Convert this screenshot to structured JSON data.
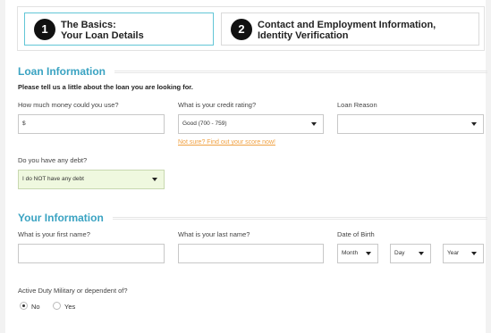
{
  "steps": [
    {
      "number": "1",
      "line1": "The Basics:",
      "line2": "Your Loan Details",
      "active": true
    },
    {
      "number": "2",
      "line1": "Contact and Employment Information,",
      "line2": "Identity Verification",
      "active": false
    }
  ],
  "loan_section": {
    "title": "Loan Information",
    "intro": "Please tell us a little about the loan you are looking for.",
    "amount": {
      "label": "How much money could you use?",
      "value": "$"
    },
    "credit": {
      "label": "What is your credit rating?",
      "value": "Good (700 - 759)"
    },
    "reason": {
      "label": "Loan Reason",
      "value": ""
    },
    "credit_help_link": "Not sure? Find out your score now!",
    "debt": {
      "label": "Do you have any debt?",
      "value": "I do NOT have any debt"
    }
  },
  "info_section": {
    "title": "Your Information",
    "first_name": {
      "label": "What is your first name?",
      "value": ""
    },
    "last_name": {
      "label": "What is your last name?",
      "value": ""
    },
    "dob": {
      "label": "Date of Birth",
      "month": "Month",
      "day": "Day",
      "year": "Year"
    },
    "military": {
      "label": "Active Duty Military or dependent of?",
      "options": [
        {
          "label": "No",
          "checked": true
        },
        {
          "label": "Yes",
          "checked": false
        }
      ]
    }
  },
  "colors": {
    "accent": "#3aa3c2",
    "link": "#f0a040",
    "debt_bg": "#eff8df",
    "active_step_border": "#62c6d6"
  }
}
